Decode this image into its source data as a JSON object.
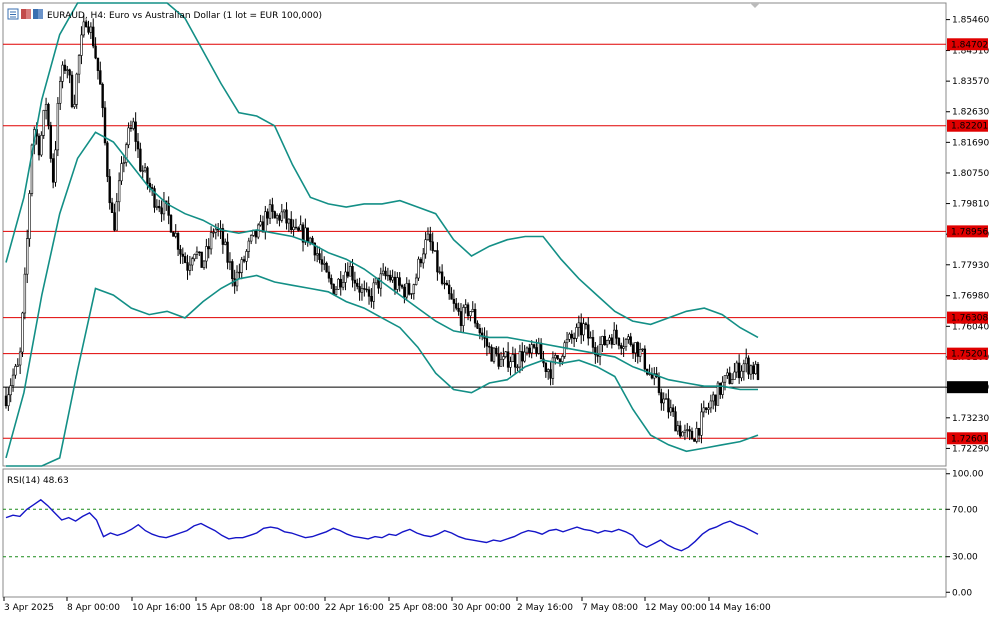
{
  "title": "EURAUD, H4:  Euro vs Australian Dollar (1 lot = EUR 100,000)",
  "colors": {
    "candle": "#000000",
    "bollinger": "#138f86",
    "level_line": "#e00000",
    "level_label_bg": "#e00000",
    "rsi_line": "#1515c8",
    "rsi_level": "#1a8a1a"
  },
  "chart_data": [
    {
      "type": "candlestick",
      "title": "EURAUD, H4:  Euro vs Australian Dollar (1 lot = EUR 100,000)",
      "ylim": [
        1.7175,
        1.8597
      ],
      "y_ticks": [
        "1.85460",
        "1.84510",
        "1.83570",
        "1.82630",
        "1.81690",
        "1.80750",
        "1.79810",
        "1.78870",
        "1.77930",
        "1.76980",
        "1.76040",
        "1.75100",
        "1.74170",
        "1.73230",
        "1.72290"
      ],
      "x_ticks": [
        "3 Apr 2025",
        "8 Apr 00:00",
        "10 Apr 16:00",
        "15 Apr 08:00",
        "18 Apr 00:00",
        "22 Apr 16:00",
        "25 Apr 08:00",
        "30 Apr 00:00",
        "2 May 16:00",
        "7 May 08:00",
        "12 May 00:00",
        "14 May 16:00"
      ],
      "levels": [
        {
          "label": "1.84702",
          "value": 1.84702
        },
        {
          "label": "1.82201",
          "value": 1.82201
        },
        {
          "label": "1.78956",
          "value": 1.78956
        },
        {
          "label": "1.76308",
          "value": 1.76308
        },
        {
          "label": "1.75201",
          "value": 1.75201
        },
        {
          "label": "1.72601",
          "value": 1.72601
        }
      ],
      "current_price": {
        "label": "1.74171",
        "value": 1.74171
      },
      "close_path": [
        1.739,
        1.745,
        1.748,
        1.78,
        1.823,
        1.815,
        1.83,
        1.805,
        1.835,
        1.842,
        1.828,
        1.845,
        1.856,
        1.848,
        1.835,
        1.81,
        1.79,
        1.805,
        1.818,
        1.822,
        1.81,
        1.805,
        1.8,
        1.798,
        1.795,
        1.79,
        1.784,
        1.779,
        1.785,
        1.779,
        1.783,
        1.791,
        1.788,
        1.781,
        1.775,
        1.778,
        1.784,
        1.788,
        1.79,
        1.796,
        1.793,
        1.795,
        1.792,
        1.788,
        1.789,
        1.788,
        1.785,
        1.779,
        1.774,
        1.772,
        1.776,
        1.779,
        1.775,
        1.771,
        1.768,
        1.773,
        1.775,
        1.776,
        1.773,
        1.772,
        1.771,
        1.775,
        1.784,
        1.787,
        1.78,
        1.773,
        1.769,
        1.765,
        1.763,
        1.766,
        1.762,
        1.757,
        1.753,
        1.751,
        1.749,
        1.751,
        1.75,
        1.752,
        1.751,
        1.754,
        1.749,
        1.747,
        1.75,
        1.754,
        1.756,
        1.758,
        1.76,
        1.756,
        1.754,
        1.755,
        1.758,
        1.757,
        1.756,
        1.756,
        1.754,
        1.75,
        1.745,
        1.742,
        1.737,
        1.734,
        1.73,
        1.727,
        1.726,
        1.729,
        1.733,
        1.737,
        1.74,
        1.743,
        1.745,
        1.747,
        1.749,
        1.748,
        1.746
      ],
      "bollinger_upper": [
        1.78,
        1.8,
        1.83,
        1.85,
        1.86,
        1.862,
        1.863,
        1.861,
        1.862,
        1.86,
        1.855,
        1.845,
        1.835,
        1.826,
        1.825,
        1.822,
        1.81,
        1.8,
        1.798,
        1.797,
        1.798,
        1.798,
        1.799,
        1.797,
        1.795,
        1.787,
        1.782,
        1.785,
        1.787,
        1.788,
        1.788,
        1.781,
        1.775,
        1.77,
        1.765,
        1.762,
        1.761,
        1.763,
        1.765,
        1.766,
        1.764,
        1.76,
        1.757
      ],
      "bollinger_middle": [
        1.72,
        1.74,
        1.77,
        1.795,
        1.812,
        1.82,
        1.817,
        1.81,
        1.803,
        1.798,
        1.795,
        1.793,
        1.79,
        1.789,
        1.79,
        1.789,
        1.788,
        1.786,
        1.783,
        1.781,
        1.778,
        1.774,
        1.77,
        1.766,
        1.762,
        1.759,
        1.758,
        1.757,
        1.757,
        1.756,
        1.755,
        1.754,
        1.753,
        1.752,
        1.751,
        1.748,
        1.746,
        1.744,
        1.743,
        1.742,
        1.742,
        1.741,
        1.741
      ],
      "bollinger_lower": [
        1.66,
        1.68,
        1.7,
        1.72,
        1.747,
        1.772,
        1.77,
        1.766,
        1.764,
        1.765,
        1.763,
        1.768,
        1.772,
        1.775,
        1.776,
        1.774,
        1.773,
        1.772,
        1.771,
        1.768,
        1.766,
        1.763,
        1.76,
        1.754,
        1.746,
        1.741,
        1.74,
        1.743,
        1.744,
        1.748,
        1.75,
        1.749,
        1.75,
        1.748,
        1.745,
        1.735,
        1.727,
        1.724,
        1.722,
        1.723,
        1.724,
        1.725,
        1.727
      ]
    },
    {
      "type": "line",
      "title": "RSI(14) 48.63",
      "ylim": [
        -4,
        104
      ],
      "y_ticks": [
        "100.00",
        "70.00",
        "30.00",
        "0.00"
      ],
      "levels": [
        70,
        30
      ],
      "values": [
        63,
        65,
        64,
        70,
        74,
        78,
        73,
        67,
        61,
        63,
        60,
        64,
        67,
        61,
        47,
        50,
        48,
        50,
        53,
        57,
        52,
        49,
        47,
        46,
        48,
        50,
        52,
        56,
        58,
        55,
        52,
        48,
        45,
        46,
        46,
        48,
        50,
        54,
        55,
        54,
        51,
        50,
        48,
        46,
        47,
        49,
        51,
        54,
        52,
        49,
        47,
        46,
        45,
        47,
        46,
        49,
        48,
        51,
        53,
        50,
        48,
        47,
        49,
        52,
        50,
        47,
        45,
        44,
        43,
        42,
        44,
        43,
        45,
        47,
        50,
        52,
        51,
        49,
        52,
        53,
        51,
        53,
        55,
        53,
        52,
        50,
        52,
        51,
        53,
        51,
        48,
        41,
        38,
        41,
        44,
        40,
        37,
        35,
        38,
        43,
        49,
        53,
        55,
        58,
        60,
        57,
        55,
        52,
        49
      ]
    }
  ]
}
